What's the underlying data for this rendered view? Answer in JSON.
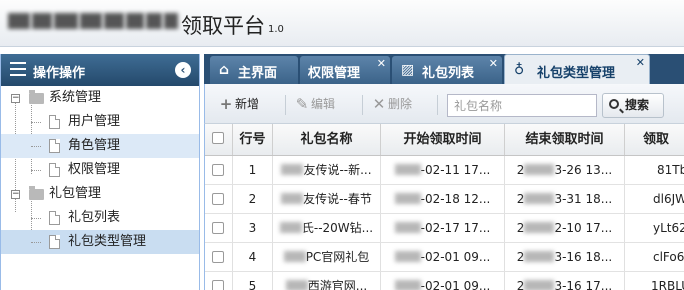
{
  "app": {
    "title": "领取平台",
    "version": "1.0"
  },
  "sidebar": {
    "title": "操作操作",
    "tree": [
      {
        "label": "系统管理",
        "type": "folder"
      },
      {
        "label": "用户管理",
        "type": "leaf"
      },
      {
        "label": "角色管理",
        "type": "leaf"
      },
      {
        "label": "权限管理",
        "type": "leaf"
      },
      {
        "label": "礼包管理",
        "type": "folder"
      },
      {
        "label": "礼包列表",
        "type": "leaf"
      },
      {
        "label": "礼包类型管理",
        "type": "leaf"
      }
    ]
  },
  "tabs": [
    {
      "label": "主界面",
      "icon": "home-icon"
    },
    {
      "label": "权限管理",
      "icon": ""
    },
    {
      "label": "礼包列表",
      "icon": "image-icon"
    },
    {
      "label": "礼包类型管理",
      "icon": "gift-icon"
    }
  ],
  "toolbar": {
    "add_label": "新增",
    "edit_label": "编辑",
    "delete_label": "删除",
    "search_placeholder": "礼包名称",
    "search_label": "搜索"
  },
  "grid": {
    "columns": [
      "行号",
      "礼包名称",
      "开始领取时间",
      "结束领取时间",
      "领取"
    ],
    "rows": [
      {
        "num": "1",
        "name": "友传说--新...",
        "start": "-02-11 17...",
        "end": "3-26 13...",
        "code": "81Tb"
      },
      {
        "num": "2",
        "name": "友传说--春节",
        "start": "-02-18 12...",
        "end": "3-31 18...",
        "code": "dl6JW"
      },
      {
        "num": "3",
        "name": "氏--20W钻...",
        "start": "-02-17 17...",
        "end": "2-10 17...",
        "code": "yLt62"
      },
      {
        "num": "4",
        "name": "PC官网礼包",
        "start": "-02-01 09...",
        "end": "3-16 18...",
        "code": "clFo6"
      },
      {
        "num": "5",
        "name": "西游官网...",
        "start": "-02-01 09...",
        "end": "3-16 17...",
        "code": "1RBLU"
      }
    ]
  },
  "colors": {
    "sidebar_header": "#2a4f74",
    "tab_bar": "#2a4f74",
    "selected_node": "#c9ddf1"
  }
}
